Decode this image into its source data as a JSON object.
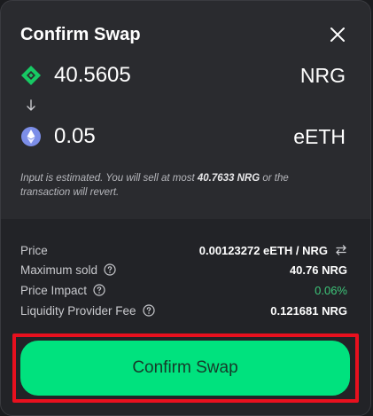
{
  "modal": {
    "title": "Confirm Swap"
  },
  "input_token": {
    "amount": "40.5605",
    "symbol": "NRG",
    "icon": "nrg-token-icon",
    "color": "#17c964"
  },
  "output_token": {
    "amount": "0.05",
    "symbol": "eETH",
    "icon": "eth-token-icon",
    "color": "#7c8ee8"
  },
  "note": {
    "prefix": "Input is estimated. You will sell at most ",
    "max_amount": "40.7633 NRG",
    "suffix": " or the transaction will revert."
  },
  "details": {
    "price_label": "Price",
    "price_value": "0.00123272 eETH / NRG",
    "max_sold_label": "Maximum sold",
    "max_sold_value": "40.76 NRG",
    "impact_label": "Price Impact",
    "impact_value": "0.06%",
    "impact_color": "#3ec67a",
    "fee_label": "Liquidity Provider Fee",
    "fee_value": "0.121681 NRG"
  },
  "cta": {
    "label": "Confirm Swap",
    "color": "#00e27e"
  },
  "highlight_color": "#e8101e"
}
